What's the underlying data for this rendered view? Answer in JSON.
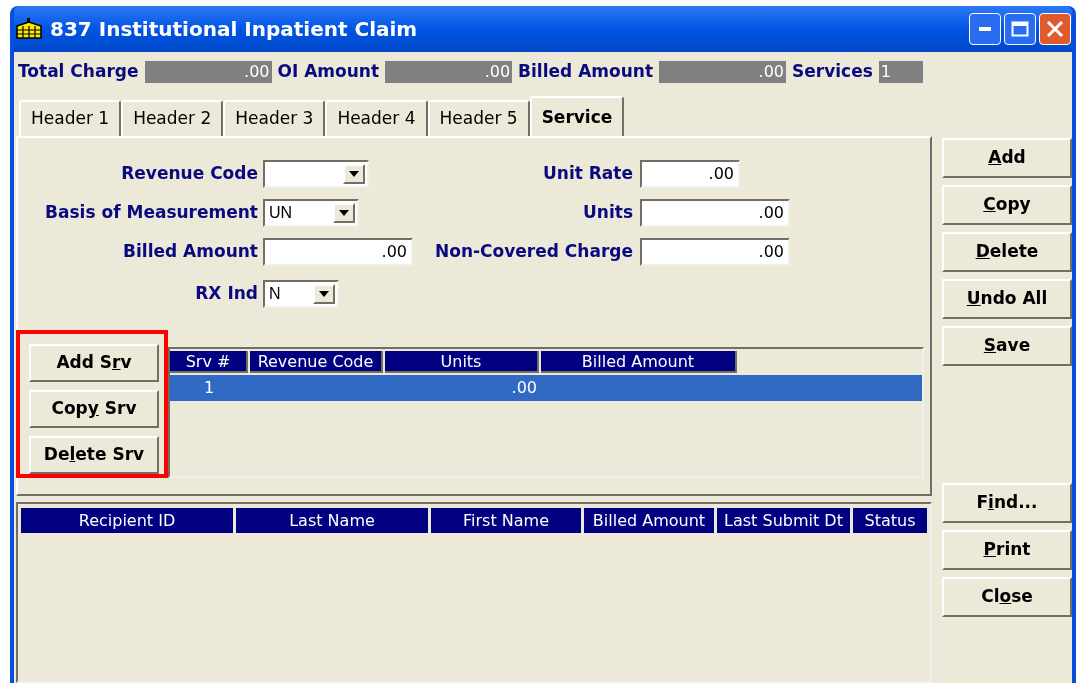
{
  "window": {
    "title": "837 Institutional Inpatient Claim",
    "controls": [
      {
        "kind": "minimize"
      },
      {
        "kind": "maximize"
      },
      {
        "kind": "close"
      }
    ]
  },
  "summary": [
    {
      "label": "Total Charge",
      "value": ".00"
    },
    {
      "label": "OI Amount",
      "value": ".00"
    },
    {
      "label": "Billed Amount",
      "value": ".00"
    },
    {
      "label": "Services",
      "value": "1",
      "kind": "short"
    }
  ],
  "tabs": [
    {
      "label": "Header 1",
      "selected": false
    },
    {
      "label": "Header 2",
      "selected": false
    },
    {
      "label": "Header 3",
      "selected": false
    },
    {
      "label": "Header 4",
      "selected": false
    },
    {
      "label": "Header 5",
      "selected": false
    },
    {
      "label": "Service",
      "selected": true
    }
  ],
  "form_rows": [
    {
      "left": {
        "label": "Revenue Code",
        "kind": "combo"
      },
      "right": {
        "label": "Unit Rate",
        "kind": "text",
        "value": ".00"
      }
    },
    {
      "left": {
        "label": "Basis of Measurement",
        "kind": "combo",
        "value": "UN"
      },
      "right": {
        "label": "Units",
        "kind": "text",
        "value": ".00"
      }
    },
    {
      "left": {
        "label": "Billed Amount",
        "kind": "text",
        "value": ".00"
      },
      "right": {
        "label": "Non-Covered Charge",
        "kind": "text",
        "value": ".00"
      }
    },
    {
      "left": {
        "label": "RX Ind",
        "kind": "combo",
        "value": "N"
      }
    }
  ],
  "service_buttons": {
    "highlighted": true,
    "buttons": [
      {
        "pre": "Add S",
        "key": "r",
        "post": "v"
      },
      {
        "pre": "Cop",
        "key": "y",
        "post": " Srv"
      },
      {
        "pre": "De",
        "key": "l",
        "post": "ete Srv"
      }
    ]
  },
  "service_table": {
    "columns": [
      "Srv #",
      "Revenue Code",
      "Units",
      "Billed Amount"
    ],
    "rows": [
      {
        "selected": true,
        "cells": [
          "1",
          "",
          ".00",
          ""
        ]
      }
    ]
  },
  "side_buttons_top": [
    {
      "key": "A",
      "post": "dd"
    },
    {
      "key": "C",
      "post": "opy"
    },
    {
      "key": "D",
      "post": "elete"
    },
    {
      "key": "U",
      "post": "ndo All"
    },
    {
      "key": "S",
      "post": "ave"
    }
  ],
  "side_buttons_bottom": [
    {
      "pre": "F",
      "key": "i",
      "post": "nd..."
    },
    {
      "key": "P",
      "post": "rint"
    },
    {
      "pre": "Cl",
      "key": "o",
      "post": "se"
    }
  ],
  "results_table": {
    "columns": [
      "Recipient ID",
      "Last Name",
      "First Name",
      "Billed Amount",
      "Last Submit Dt",
      "Status"
    ]
  }
}
